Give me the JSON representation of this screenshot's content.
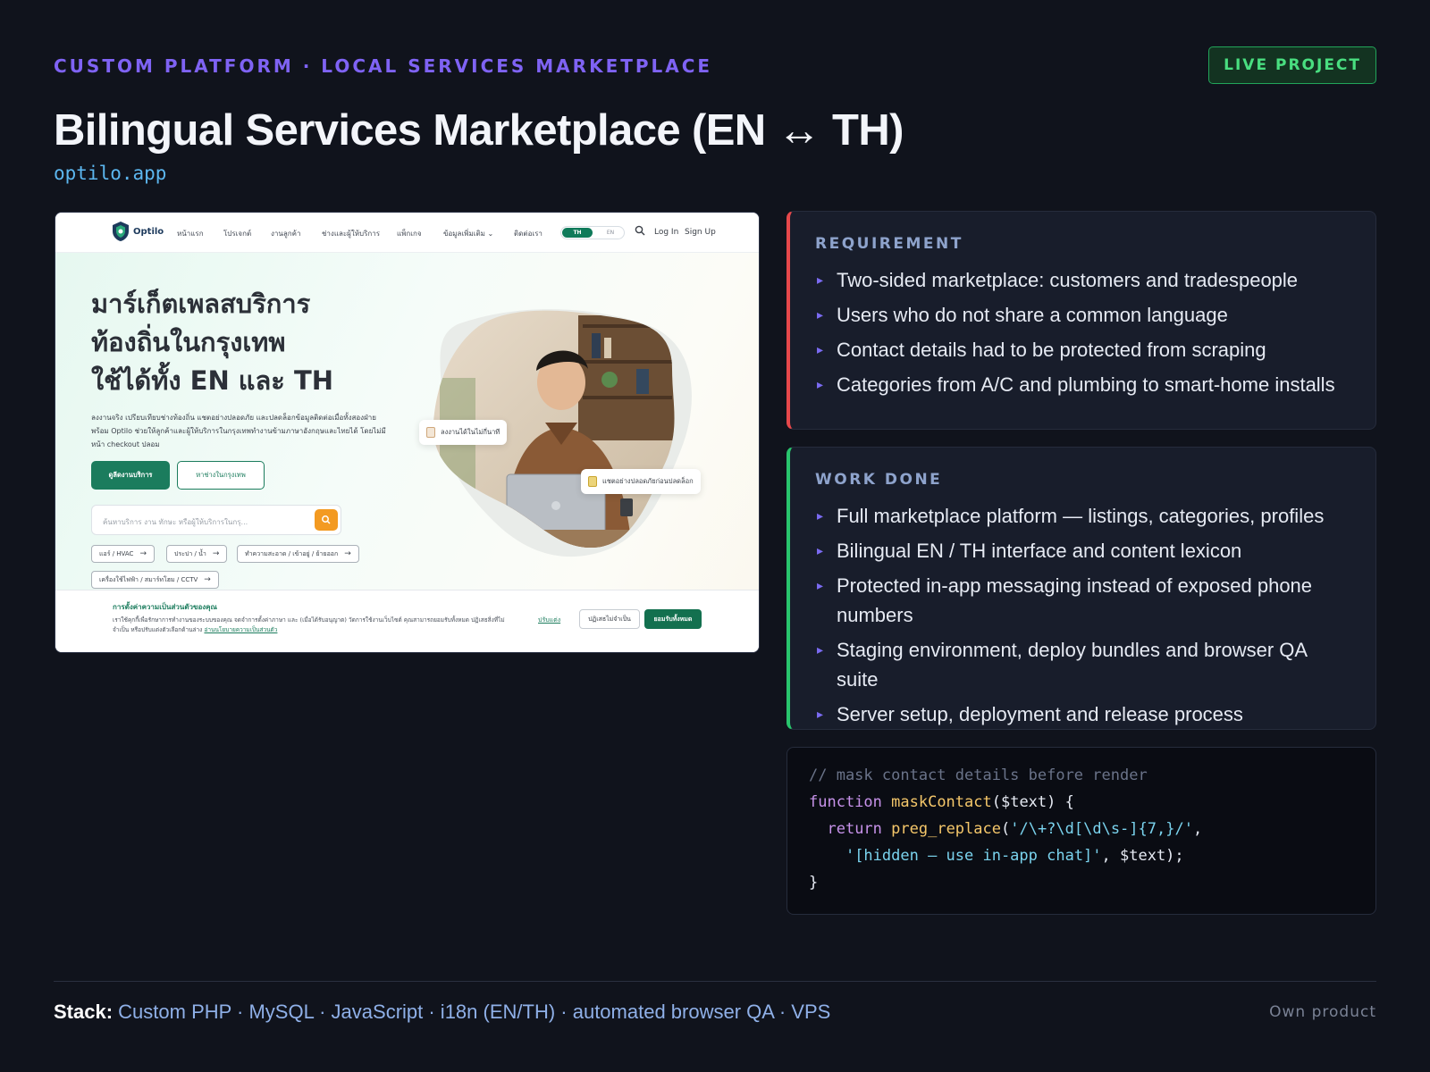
{
  "header": {
    "eyebrow": "CUSTOM PLATFORM · LOCAL SERVICES MARKETPLACE",
    "badge": "LIVE PROJECT",
    "title": "Bilingual Services Marketplace (EN ↔ TH)",
    "url": "optilo.app"
  },
  "screenshot": {
    "logo_text": "Optilo",
    "nav_links": [
      "หน้าแรก",
      "โปรเจกต์",
      "งานลูกค้า",
      "ช่างและผู้ให้บริการ",
      "แพ็กเกจ",
      "ข้อมูลเพิ่มเติม",
      "ติดต่อเรา"
    ],
    "lang_th": "TH",
    "lang_en": "EN",
    "login": "Log In",
    "signup": "Sign Up",
    "hero_heading": [
      "มาร์เก็ตเพลสบริการ",
      "ท้องถิ่นในกรุงเทพ",
      "ใช้ได้ทั้ง EN และ TH"
    ],
    "hero_paragraph": "ลงงานจริง เปรียบเทียบช่างท้องถิ่น แชตอย่างปลอดภัย และปลดล็อกข้อมูลติดต่อเมื่อทั้งสองฝ่ายพร้อม Optilo ช่วยให้ลูกค้าและผู้ให้บริการในกรุงเทพทำงานข้ามภาษาอังกฤษและไทยได้ โดยไม่มีหน้า checkout ปลอม",
    "btn_primary": "ดูลีดงานบริการ",
    "btn_secondary": "หาช่างในกรุงเทพ",
    "search_placeholder": "ค้นหาบริการ งาน ทักษะ หรือผู้ให้บริการในกรุ...",
    "chips": [
      "แอร์ / HVAC",
      "ประปา / น้ำ",
      "ทำความสะอาด / เข้าอยู่ / ย้ายออก",
      "เครื่องใช้ไฟฟ้า / สมาร์ทโฮม / CCTV"
    ],
    "float_card_1": "ลงงานได้ในไม่กี่นาที",
    "float_card_2": "แชตอย่างปลอดภัยก่อนปลดล็อก",
    "consent_title": "การตั้งค่าความเป็นส่วนตัวของคุณ",
    "consent_body": "เราใช้คุกกี้เพื่อรักษาการทำงานของระบบของคุณ จดจำการตั้งค่าภาษา และ (เมื่อได้รับอนุญาต) วัดการใช้งานเว็บไซต์ คุณสามารถยอมรับทั้งหมด ปฏิเสธสิ่งที่ไม่จำเป็น หรือปรับแต่งตัวเลือกด้านล่าง",
    "consent_link": "อ่านนโยบายความเป็นส่วนตัว",
    "consent_customize": "ปรับแต่ง",
    "consent_reject": "ปฏิเสธไม่จำเป็น",
    "consent_accept": "ยอมรับทั้งหมด"
  },
  "requirement": {
    "label": "REQUIREMENT",
    "items": [
      "Two-sided marketplace: customers and tradespeople",
      "Users who do not share a common language",
      "Contact details had to be protected from scraping",
      "Categories from A/C and plumbing to smart-home installs"
    ]
  },
  "work_done": {
    "label": "WORK DONE",
    "items": [
      "Full marketplace platform — listings, categories, profiles",
      "Bilingual EN / TH interface and content lexicon",
      "Protected in-app messaging instead of exposed phone numbers",
      "Staging environment, deploy bundles and browser QA suite",
      "Server setup, deployment and release process"
    ]
  },
  "code": {
    "comment": "// mask contact details before render",
    "kw_function": "function",
    "fn_name": "maskContact",
    "params": "($text) {",
    "kw_return": "return",
    "fn_call": "preg_replace",
    "open_paren": "(",
    "regex": "'/\\+?\\d[\\d\\s-]{7,}/'",
    "comma1": ",",
    "replacement": "'[hidden — use in-app chat]'",
    "tail": ", $text);",
    "close": "}"
  },
  "footer": {
    "stack_label": "Stack:",
    "stack_items": "Custom PHP · MySQL · JavaScript · i18n (EN/TH) · automated browser QA · VPS",
    "own": "Own product"
  },
  "colors": {
    "accent_purple": "#7f63f4",
    "live_green": "#49de80",
    "requirement_red": "#e6484b",
    "work_green": "#29c56d",
    "brand_green": "#1b7c5d",
    "search_orange": "#f39a21"
  }
}
